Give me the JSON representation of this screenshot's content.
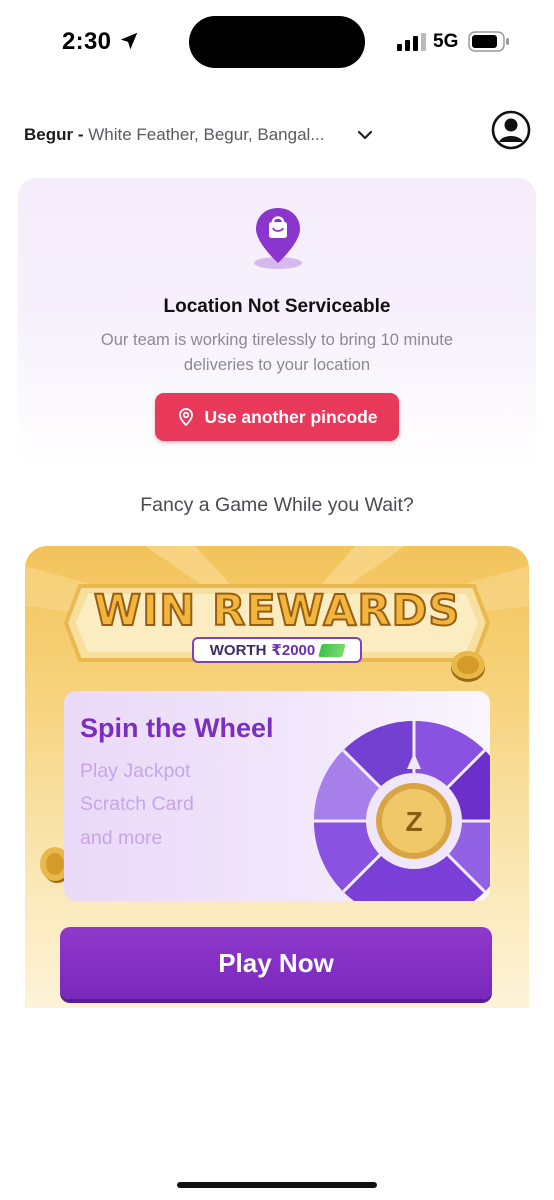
{
  "status_bar": {
    "time": "2:30",
    "network": "5G"
  },
  "header": {
    "location_short": "Begur -",
    "location_full": "White Feather, Begur, Bangal...",
    "chevron_icon": "chevron-down-icon",
    "profile_icon": "person-circle-icon"
  },
  "location_card": {
    "pin_icon": "shopping-bag-pin-icon",
    "title": "Location Not Serviceable",
    "description": "Our team is working tirelessly to bring 10 minute deliveries to your location",
    "button_label": "Use another pincode",
    "button_color": "#e8395a"
  },
  "game_prompt": "Fancy a Game While you Wait?",
  "rewards": {
    "headline": "WIN REWARDS",
    "worth_label": "WORTH",
    "worth_value": "₹2000",
    "spin_card": {
      "title": "Spin the Wheel",
      "items": [
        "Play Jackpot",
        "Scratch Card",
        "and more"
      ],
      "wheel_center": "Z"
    },
    "play_button_label": "Play Now",
    "accent_color": "#7a2fbf"
  }
}
